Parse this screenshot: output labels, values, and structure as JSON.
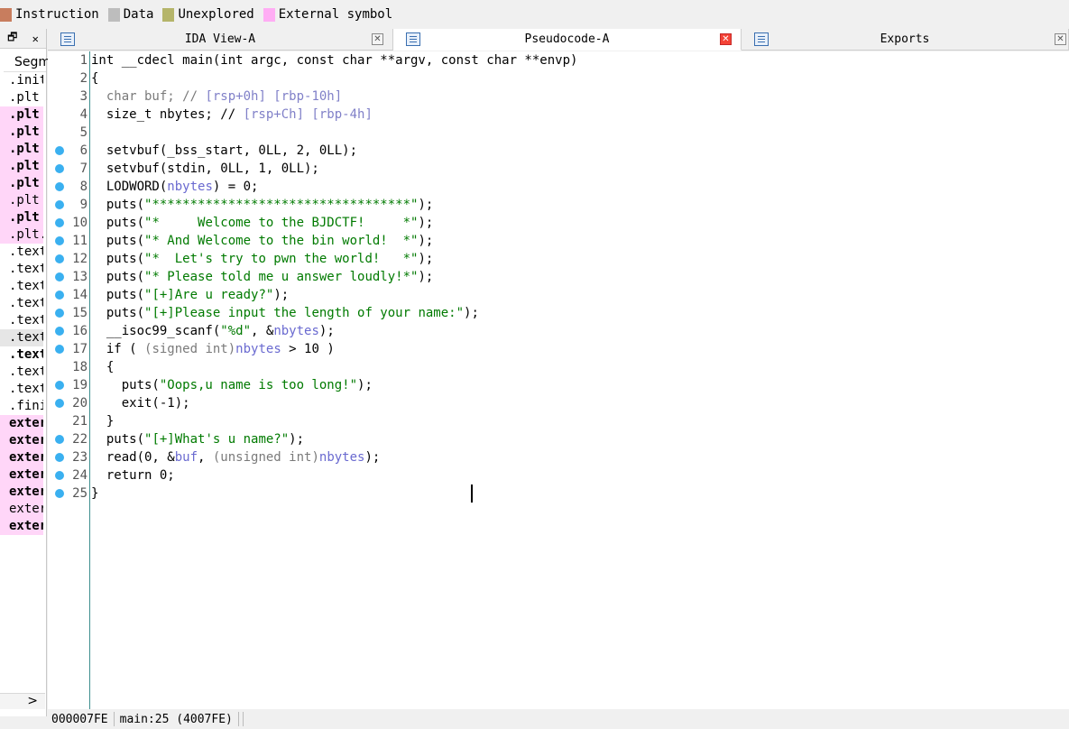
{
  "legend": [
    {
      "label": "Instruction",
      "color": "#c87d5e"
    },
    {
      "label": "Data",
      "color": "#bdbdbd"
    },
    {
      "label": "Unexplored",
      "color": "#b5b56a"
    },
    {
      "label": "External symbol",
      "color": "#ffadf4"
    }
  ],
  "left_panel": {
    "header": "Segm",
    "segments": [
      {
        "name": ".init",
        "style": ""
      },
      {
        "name": ".plt",
        "style": ""
      },
      {
        "name": ".plt",
        "style": "pink bold"
      },
      {
        "name": ".plt",
        "style": "pink bold"
      },
      {
        "name": ".plt",
        "style": "pink bold"
      },
      {
        "name": ".plt",
        "style": "pink bold"
      },
      {
        "name": ".plt",
        "style": "pink bold"
      },
      {
        "name": ".plt",
        "style": "pink"
      },
      {
        "name": ".plt",
        "style": "pink bold"
      },
      {
        "name": ".plt.",
        "style": "pink"
      },
      {
        "name": ".text",
        "style": ""
      },
      {
        "name": ".text",
        "style": ""
      },
      {
        "name": ".text",
        "style": ""
      },
      {
        "name": ".text",
        "style": ""
      },
      {
        "name": ".text",
        "style": ""
      },
      {
        "name": ".text",
        "style": "sel"
      },
      {
        "name": ".text",
        "style": "bold"
      },
      {
        "name": ".text",
        "style": ""
      },
      {
        "name": ".text",
        "style": ""
      },
      {
        "name": ".fini",
        "style": ""
      },
      {
        "name": "exter",
        "style": "pink bold"
      },
      {
        "name": "exter",
        "style": "pink bold"
      },
      {
        "name": "exter",
        "style": "pink bold"
      },
      {
        "name": "exter",
        "style": "pink bold"
      },
      {
        "name": "exter",
        "style": "pink bold"
      },
      {
        "name": "exter",
        "style": "pink"
      },
      {
        "name": "exter",
        "style": "pink bold"
      }
    ],
    "scroll_arrow": ">"
  },
  "tabs": [
    {
      "label": "IDA View-A",
      "active": false
    },
    {
      "label": "Pseudocode-A",
      "active": true
    },
    {
      "label": "Exports",
      "active": false
    }
  ],
  "code_lines": [
    {
      "n": "1",
      "dot": false,
      "html": [
        [
          "int __cdecl main(int argc, const char **argv, const char **envp)",
          "c-ty"
        ]
      ]
    },
    {
      "n": "2",
      "dot": false,
      "html": [
        [
          "{",
          "c-ty"
        ]
      ]
    },
    {
      "n": "3",
      "dot": false,
      "html": [
        [
          "  char buf; // ",
          "c-gr"
        ],
        [
          "[rsp+0h] [rbp-10h]",
          "c-cm"
        ]
      ]
    },
    {
      "n": "4",
      "dot": false,
      "html": [
        [
          "  size_t nbytes; // ",
          "c-ty"
        ],
        [
          "[rsp+Ch] [rbp-4h]",
          "c-cm"
        ]
      ]
    },
    {
      "n": "5",
      "dot": false,
      "html": [
        [
          "",
          "c-ty"
        ]
      ]
    },
    {
      "n": "6",
      "dot": true,
      "html": [
        [
          "  setvbuf(_bss_start, 0LL, 2, 0LL);",
          "c-ty"
        ]
      ]
    },
    {
      "n": "7",
      "dot": true,
      "html": [
        [
          "  setvbuf(stdin, 0LL, 1, 0LL);",
          "c-ty"
        ]
      ]
    },
    {
      "n": "8",
      "dot": true,
      "html": [
        [
          "  LODWORD(",
          "c-ty"
        ],
        [
          "nbytes",
          "c-var"
        ],
        [
          ") = 0;",
          "c-ty"
        ]
      ]
    },
    {
      "n": "9",
      "dot": true,
      "html": [
        [
          "  puts(",
          "c-ty"
        ],
        [
          "\"**********************************\"",
          "c-str"
        ],
        [
          ");",
          "c-ty"
        ]
      ]
    },
    {
      "n": "10",
      "dot": true,
      "html": [
        [
          "  puts(",
          "c-ty"
        ],
        [
          "\"*     Welcome to the BJDCTF!     *\"",
          "c-str"
        ],
        [
          ");",
          "c-ty"
        ]
      ]
    },
    {
      "n": "11",
      "dot": true,
      "html": [
        [
          "  puts(",
          "c-ty"
        ],
        [
          "\"* And Welcome to the bin world!  *\"",
          "c-str"
        ],
        [
          ");",
          "c-ty"
        ]
      ]
    },
    {
      "n": "12",
      "dot": true,
      "html": [
        [
          "  puts(",
          "c-ty"
        ],
        [
          "\"*  Let's try to pwn the world!   *\"",
          "c-str"
        ],
        [
          ");",
          "c-ty"
        ]
      ]
    },
    {
      "n": "13",
      "dot": true,
      "html": [
        [
          "  puts(",
          "c-ty"
        ],
        [
          "\"* Please told me u answer loudly!*\"",
          "c-str"
        ],
        [
          ");",
          "c-ty"
        ]
      ]
    },
    {
      "n": "14",
      "dot": true,
      "html": [
        [
          "  puts(",
          "c-ty"
        ],
        [
          "\"[+]Are u ready?\"",
          "c-str"
        ],
        [
          ");",
          "c-ty"
        ]
      ]
    },
    {
      "n": "15",
      "dot": true,
      "html": [
        [
          "  puts(",
          "c-ty"
        ],
        [
          "\"[+]Please input the length of your name:\"",
          "c-str"
        ],
        [
          ");",
          "c-ty"
        ]
      ]
    },
    {
      "n": "16",
      "dot": true,
      "html": [
        [
          "  __isoc99_scanf(",
          "c-ty"
        ],
        [
          "\"%d\"",
          "c-str"
        ],
        [
          ", &",
          "c-ty"
        ],
        [
          "nbytes",
          "c-var"
        ],
        [
          ");",
          "c-ty"
        ]
      ]
    },
    {
      "n": "17",
      "dot": true,
      "html": [
        [
          "  if ( ",
          "c-ty"
        ],
        [
          "(signed int)",
          "c-gr"
        ],
        [
          "nbytes",
          "c-var"
        ],
        [
          " > 10 )",
          "c-ty"
        ]
      ]
    },
    {
      "n": "18",
      "dot": false,
      "html": [
        [
          "  {",
          "c-ty"
        ]
      ]
    },
    {
      "n": "19",
      "dot": true,
      "html": [
        [
          "    puts(",
          "c-ty"
        ],
        [
          "\"Oops,u name is too long!\"",
          "c-str"
        ],
        [
          ");",
          "c-ty"
        ]
      ]
    },
    {
      "n": "20",
      "dot": true,
      "html": [
        [
          "    exit(-1);",
          "c-ty"
        ]
      ]
    },
    {
      "n": "21",
      "dot": false,
      "html": [
        [
          "  }",
          "c-ty"
        ]
      ]
    },
    {
      "n": "22",
      "dot": true,
      "html": [
        [
          "  puts(",
          "c-ty"
        ],
        [
          "\"[+]What's u name?\"",
          "c-str"
        ],
        [
          ");",
          "c-ty"
        ]
      ]
    },
    {
      "n": "23",
      "dot": true,
      "html": [
        [
          "  read(0, &",
          "c-ty"
        ],
        [
          "buf",
          "c-var"
        ],
        [
          ", ",
          "c-ty"
        ],
        [
          "(unsigned int)",
          "c-gr"
        ],
        [
          "nbytes",
          "c-var"
        ],
        [
          ");",
          "c-ty"
        ]
      ]
    },
    {
      "n": "24",
      "dot": true,
      "html": [
        [
          "  return 0;",
          "c-ty"
        ]
      ]
    },
    {
      "n": "25",
      "dot": true,
      "html": [
        [
          "}",
          "c-ty"
        ]
      ]
    }
  ],
  "status": {
    "address": "000007FE",
    "location": "main:25 (4007FE)"
  }
}
